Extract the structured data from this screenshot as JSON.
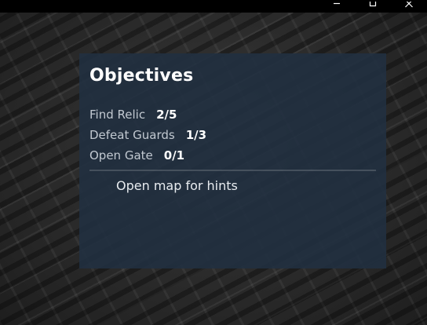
{
  "window_controls": {
    "icons": [
      "minimize-icon",
      "maximize-icon",
      "close-icon"
    ]
  },
  "objectives_panel": {
    "title": "Objectives",
    "items": [
      {
        "label": "Find Relic",
        "progress": "2/5"
      },
      {
        "label": "Defeat Guards",
        "progress": "1/3"
      },
      {
        "label": "Open Gate",
        "progress": "0/1"
      }
    ],
    "hint": "Open map for hints"
  },
  "colors": {
    "panel_bg": "#213040",
    "title_bar": "#000000",
    "label_text": "#c2c9d1",
    "value_text": "#ffffff"
  }
}
